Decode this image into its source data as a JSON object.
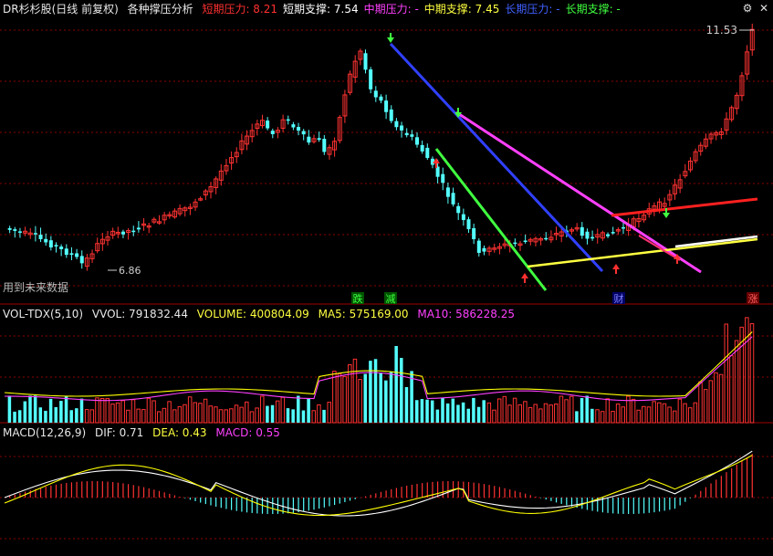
{
  "main_header": {
    "stock": "DR杉杉股(日线 前复权)",
    "indicator": "各种撑压分析",
    "items": [
      {
        "label": "短期压力: 8.21",
        "color": "#ff3030"
      },
      {
        "label": "短期支撑: 7.54",
        "color": "#ffffff"
      },
      {
        "label": "中期压力: -",
        "color": "#ff40ff"
      },
      {
        "label": "中期支撑: 7.45",
        "color": "#ffff40"
      },
      {
        "label": "长期压力: -",
        "color": "#4060ff"
      },
      {
        "label": "长期支撑: -",
        "color": "#40ff40"
      }
    ]
  },
  "controls": {
    "settings_glyph": "⚙",
    "close_glyph": "✕"
  },
  "vol_header": {
    "name": "VOL-TDX(5,10)",
    "vvol": "VVOL: 791832.44",
    "volume": "VOLUME: 400804.09",
    "ma5": "MA5: 575169.00",
    "ma10": "MA10: 586228.25"
  },
  "macd_header": {
    "name": "MACD(12,26,9)",
    "dif": "DIF: 0.71",
    "dea": "DEA: 0.43",
    "macd": "MACD: 0.55"
  },
  "labels": {
    "price_high": "11.53",
    "price_low": "6.86",
    "future_data": "用到未来数据",
    "marker_die": "跌",
    "marker_jian": "减",
    "marker_cai": "财",
    "marker_zhang": "涨"
  },
  "colors": {
    "up": "#ff3232",
    "down": "#54ffff",
    "grid": "#8b0000",
    "ma_white": "#ffffff",
    "ma_yellow": "#ffff00",
    "ma_magenta": "#ff40ff"
  },
  "chart_data": [
    {
      "type": "candlestick",
      "title": "DR杉杉股(日线 前复权)",
      "high_label": 11.53,
      "low_label": 6.86,
      "trend_lines": [
        {
          "color": "#40ff40",
          "role": "长期支撑"
        },
        {
          "color": "#3040ff",
          "role": "长期压力"
        },
        {
          "color": "#ff40ff",
          "role": "中期压力"
        },
        {
          "color": "#ffff40",
          "role": "中期支撑"
        },
        {
          "color": "#ffffff",
          "role": "短期支撑"
        },
        {
          "color": "#ff2020",
          "role": "短期压力"
        }
      ],
      "grid": true
    },
    {
      "type": "bar",
      "title": "VOL-TDX(5,10)",
      "series": [
        "VVOL",
        "VOLUME",
        "MA5",
        "MA10"
      ]
    },
    {
      "type": "line",
      "title": "MACD(12,26,9)",
      "series": [
        "DIF",
        "DEA",
        "MACD"
      ],
      "values": {
        "DIF": 0.71,
        "DEA": 0.43,
        "MACD": 0.55
      }
    }
  ]
}
